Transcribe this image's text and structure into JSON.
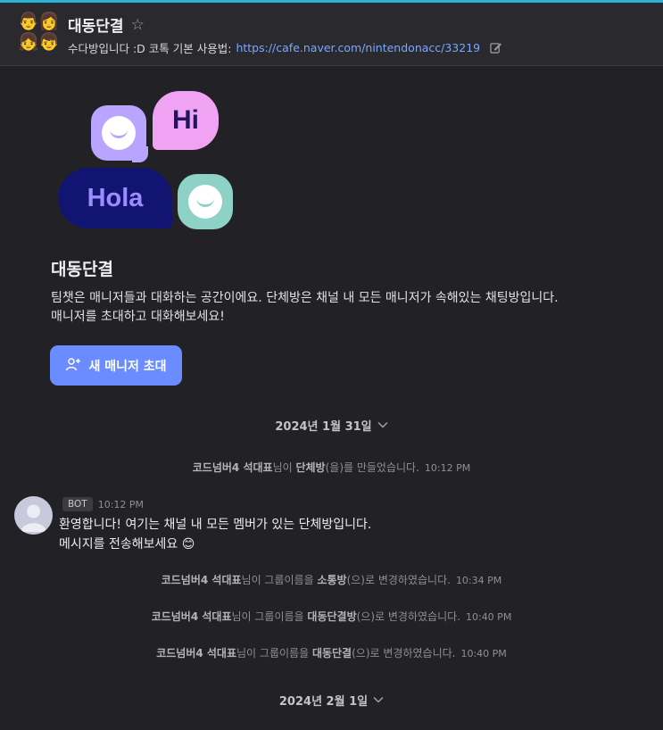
{
  "header": {
    "avatar_emojis": [
      "👨",
      "👩",
      "👧",
      "👦"
    ],
    "title": "대동단결",
    "star_icon": "star-outline-icon",
    "subtitle_text": "수다방입니다 :D 코톡 기본 사용법:",
    "subtitle_link": "https://cafe.naver.com/nintendonacc/33219",
    "edit_icon": "edit-icon"
  },
  "hero": {
    "hi_text": "Hi",
    "hola_text": "Hola"
  },
  "room": {
    "title": "대동단결",
    "description_line1": "팀챗은 매니저들과 대화하는 공간이에요. 단체방은 채널 내 모든 매니저가 속해있는 채팅방입니다.",
    "description_line2": "매니저를 초대하고 대화해보세요!",
    "invite_button": "새 매니저 초대"
  },
  "chat": {
    "date1": "2024년 1월 31일",
    "date2": "2024년 2월 1일",
    "sys1": {
      "actor": "코드넘버4 석대표",
      "mid": "님이 ",
      "room": "단체방",
      "rest": "(을)를 만들었습니다.",
      "time": "10:12 PM"
    },
    "bot_message": {
      "badge": "BOT",
      "time": "10:12 PM",
      "line1": "환영합니다! 여기는 채널 내 모든 멤버가 있는 단체방입니다.",
      "line2": "메시지를 전송해보세요 😊"
    },
    "sys2": {
      "actor": "코드넘버4 석대표",
      "mid": "님이 그룹이름을 ",
      "room": "소통방",
      "rest": "(으)로 변경하였습니다.",
      "time": "10:34 PM"
    },
    "sys3": {
      "actor": "코드넘버4 석대표",
      "mid": "님이 그룹이름을 ",
      "room": "대동단결방",
      "rest": "(으)로 변경하였습니다.",
      "time": "10:40 PM"
    },
    "sys4": {
      "actor": "코드넘버4 석대표",
      "mid": "님이 그룹이름을 ",
      "room": "대동단결",
      "rest": "(으)로 변경하였습니다.",
      "time": "10:40 PM"
    }
  },
  "colors": {
    "background": "#222226",
    "accent": "#6b8cff",
    "link": "#7aa7ff",
    "top_line": "#27b4d6"
  }
}
